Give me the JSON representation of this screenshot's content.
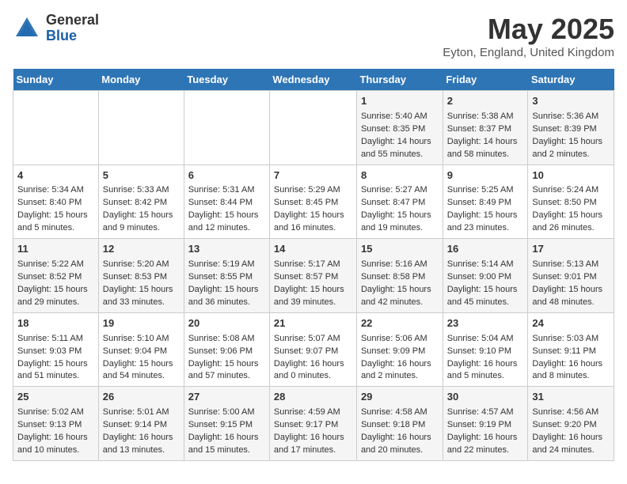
{
  "header": {
    "logo_general": "General",
    "logo_blue": "Blue",
    "title": "May 2025",
    "subtitle": "Eyton, England, United Kingdom"
  },
  "days_of_week": [
    "Sunday",
    "Monday",
    "Tuesday",
    "Wednesday",
    "Thursday",
    "Friday",
    "Saturday"
  ],
  "weeks": [
    [
      {
        "day": "",
        "info": ""
      },
      {
        "day": "",
        "info": ""
      },
      {
        "day": "",
        "info": ""
      },
      {
        "day": "",
        "info": ""
      },
      {
        "day": "1",
        "info": "Sunrise: 5:40 AM\nSunset: 8:35 PM\nDaylight: 14 hours\nand 55 minutes."
      },
      {
        "day": "2",
        "info": "Sunrise: 5:38 AM\nSunset: 8:37 PM\nDaylight: 14 hours\nand 58 minutes."
      },
      {
        "day": "3",
        "info": "Sunrise: 5:36 AM\nSunset: 8:39 PM\nDaylight: 15 hours\nand 2 minutes."
      }
    ],
    [
      {
        "day": "4",
        "info": "Sunrise: 5:34 AM\nSunset: 8:40 PM\nDaylight: 15 hours\nand 5 minutes."
      },
      {
        "day": "5",
        "info": "Sunrise: 5:33 AM\nSunset: 8:42 PM\nDaylight: 15 hours\nand 9 minutes."
      },
      {
        "day": "6",
        "info": "Sunrise: 5:31 AM\nSunset: 8:44 PM\nDaylight: 15 hours\nand 12 minutes."
      },
      {
        "day": "7",
        "info": "Sunrise: 5:29 AM\nSunset: 8:45 PM\nDaylight: 15 hours\nand 16 minutes."
      },
      {
        "day": "8",
        "info": "Sunrise: 5:27 AM\nSunset: 8:47 PM\nDaylight: 15 hours\nand 19 minutes."
      },
      {
        "day": "9",
        "info": "Sunrise: 5:25 AM\nSunset: 8:49 PM\nDaylight: 15 hours\nand 23 minutes."
      },
      {
        "day": "10",
        "info": "Sunrise: 5:24 AM\nSunset: 8:50 PM\nDaylight: 15 hours\nand 26 minutes."
      }
    ],
    [
      {
        "day": "11",
        "info": "Sunrise: 5:22 AM\nSunset: 8:52 PM\nDaylight: 15 hours\nand 29 minutes."
      },
      {
        "day": "12",
        "info": "Sunrise: 5:20 AM\nSunset: 8:53 PM\nDaylight: 15 hours\nand 33 minutes."
      },
      {
        "day": "13",
        "info": "Sunrise: 5:19 AM\nSunset: 8:55 PM\nDaylight: 15 hours\nand 36 minutes."
      },
      {
        "day": "14",
        "info": "Sunrise: 5:17 AM\nSunset: 8:57 PM\nDaylight: 15 hours\nand 39 minutes."
      },
      {
        "day": "15",
        "info": "Sunrise: 5:16 AM\nSunset: 8:58 PM\nDaylight: 15 hours\nand 42 minutes."
      },
      {
        "day": "16",
        "info": "Sunrise: 5:14 AM\nSunset: 9:00 PM\nDaylight: 15 hours\nand 45 minutes."
      },
      {
        "day": "17",
        "info": "Sunrise: 5:13 AM\nSunset: 9:01 PM\nDaylight: 15 hours\nand 48 minutes."
      }
    ],
    [
      {
        "day": "18",
        "info": "Sunrise: 5:11 AM\nSunset: 9:03 PM\nDaylight: 15 hours\nand 51 minutes."
      },
      {
        "day": "19",
        "info": "Sunrise: 5:10 AM\nSunset: 9:04 PM\nDaylight: 15 hours\nand 54 minutes."
      },
      {
        "day": "20",
        "info": "Sunrise: 5:08 AM\nSunset: 9:06 PM\nDaylight: 15 hours\nand 57 minutes."
      },
      {
        "day": "21",
        "info": "Sunrise: 5:07 AM\nSunset: 9:07 PM\nDaylight: 16 hours\nand 0 minutes."
      },
      {
        "day": "22",
        "info": "Sunrise: 5:06 AM\nSunset: 9:09 PM\nDaylight: 16 hours\nand 2 minutes."
      },
      {
        "day": "23",
        "info": "Sunrise: 5:04 AM\nSunset: 9:10 PM\nDaylight: 16 hours\nand 5 minutes."
      },
      {
        "day": "24",
        "info": "Sunrise: 5:03 AM\nSunset: 9:11 PM\nDaylight: 16 hours\nand 8 minutes."
      }
    ],
    [
      {
        "day": "25",
        "info": "Sunrise: 5:02 AM\nSunset: 9:13 PM\nDaylight: 16 hours\nand 10 minutes."
      },
      {
        "day": "26",
        "info": "Sunrise: 5:01 AM\nSunset: 9:14 PM\nDaylight: 16 hours\nand 13 minutes."
      },
      {
        "day": "27",
        "info": "Sunrise: 5:00 AM\nSunset: 9:15 PM\nDaylight: 16 hours\nand 15 minutes."
      },
      {
        "day": "28",
        "info": "Sunrise: 4:59 AM\nSunset: 9:17 PM\nDaylight: 16 hours\nand 17 minutes."
      },
      {
        "day": "29",
        "info": "Sunrise: 4:58 AM\nSunset: 9:18 PM\nDaylight: 16 hours\nand 20 minutes."
      },
      {
        "day": "30",
        "info": "Sunrise: 4:57 AM\nSunset: 9:19 PM\nDaylight: 16 hours\nand 22 minutes."
      },
      {
        "day": "31",
        "info": "Sunrise: 4:56 AM\nSunset: 9:20 PM\nDaylight: 16 hours\nand 24 minutes."
      }
    ]
  ]
}
